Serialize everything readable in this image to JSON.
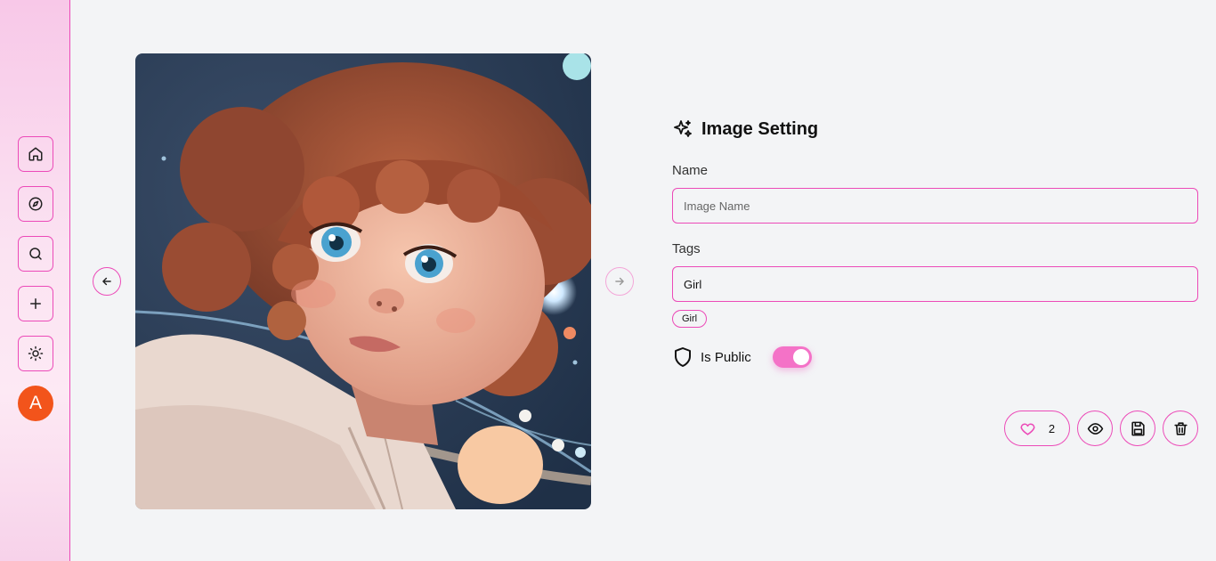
{
  "sidebar": {
    "items": [
      {
        "icon": "home-icon"
      },
      {
        "icon": "compass-icon"
      },
      {
        "icon": "search-icon"
      },
      {
        "icon": "plus-icon"
      },
      {
        "icon": "sun-icon"
      }
    ],
    "avatar_initial": "A"
  },
  "gallery": {
    "prev_icon": "arrow-left-icon",
    "next_icon": "arrow-right-icon"
  },
  "settings": {
    "title": "Image Setting",
    "name_label": "Name",
    "name_placeholder": "Image Name",
    "name_value": "",
    "tags_label": "Tags",
    "tags_value": "Girl",
    "tags": [
      "Girl"
    ],
    "public_label": "Is Public",
    "is_public": true
  },
  "actions": {
    "like_count": "2"
  },
  "colors": {
    "accent": "#ec4ab8",
    "toggle": "#f472c7",
    "avatar": "#f2541b",
    "background": "#f3f4f6"
  }
}
